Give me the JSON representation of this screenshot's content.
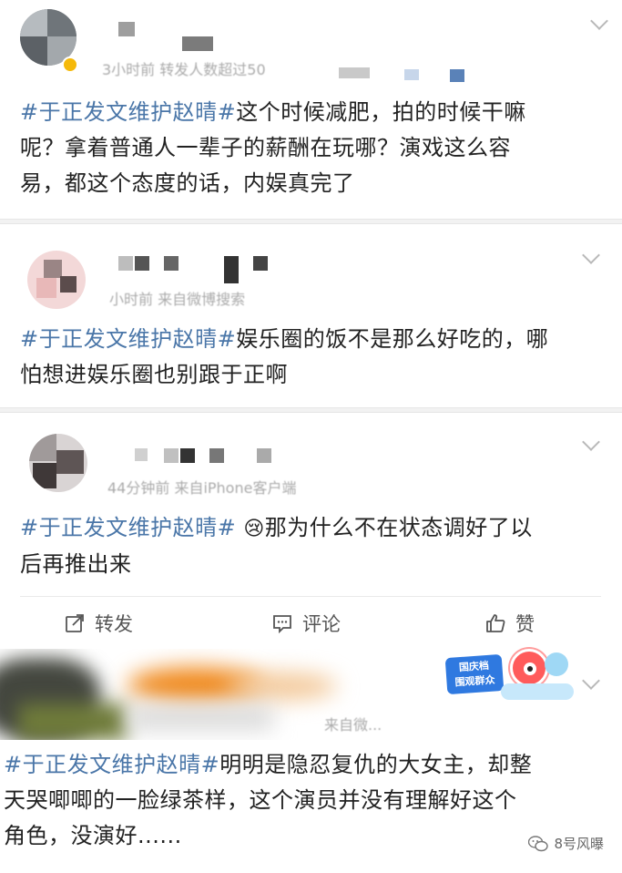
{
  "posts": [
    {
      "meta": "3小时前 转发人数超过50",
      "hashtag": "#于正发文维护赵晴#",
      "text_lines": [
        "这个时候减肥，拍的时候干嘛",
        "呢？拿着普通人一辈子的薪酬在玩哪？演戏这么容",
        "易，都这个态度的话，内娱真完了"
      ]
    },
    {
      "meta": "小时前 来自微博搜索",
      "hashtag": "#于正发文维护赵晴#",
      "text_lines": [
        "娱乐圈的饭不是那么好吃的，哪",
        "怕想进娱乐圈也别跟于正啊"
      ]
    },
    {
      "meta": "44分钟前 来自iPhone客户端",
      "hashtag": "#于正发文维护赵晴#",
      "emoji": "😢",
      "text_lines": [
        "那为什么不在状态调好了以",
        "后再推出来"
      ],
      "actions": {
        "repost": "转发",
        "comment": "评论",
        "like": "赞"
      }
    },
    {
      "meta": "来自微...",
      "hashtag": "#于正发文维护赵晴#",
      "badge_line1": "国庆档",
      "badge_line2": "围观群众",
      "text_lines": [
        "明明是隐忍复仇的大女主，却整",
        "天哭唧唧的一脸绿茶样，这个演员并没有理解好这个",
        "角色，没演好......"
      ]
    }
  ],
  "watermark": "8号风曝",
  "colors": {
    "hashtag": "#4a76a8",
    "separator": "#f2f2f2"
  },
  "icons": [
    "chevron-down-icon",
    "repost-icon",
    "comment-icon",
    "like-icon",
    "wechat-icon",
    "verified-icon"
  ]
}
